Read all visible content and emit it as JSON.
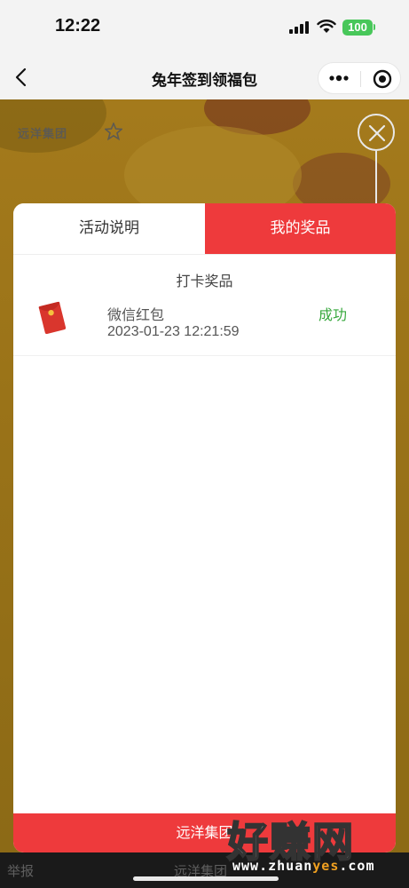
{
  "status_bar": {
    "time": "12:22",
    "battery": "100",
    "battery_color": "#48c75a"
  },
  "nav": {
    "title": "兔年签到领福包",
    "back_icon": "chevron-left-icon",
    "more_icon": "more-dots-icon",
    "target_icon": "target-icon"
  },
  "background": {
    "logo_text": "远洋集团"
  },
  "modal": {
    "tabs": [
      {
        "label": "活动说明",
        "active": false
      },
      {
        "label": "我的奖品",
        "active": true
      }
    ],
    "section_title": "打卡奖品",
    "prizes": [
      {
        "icon": "red-envelope-icon",
        "name": "微信红包",
        "time": "2023-01-23 12:21:59",
        "status": "成功",
        "status_color": "#37a83d"
      }
    ],
    "footer": "远洋集团",
    "accent_color": "#ee3a3c"
  },
  "bottom_bar": {
    "report": "举报",
    "footer": "远洋集团"
  },
  "watermark": {
    "main": "好赚网",
    "url_prefix": "www.zhuan",
    "url_highlight": "yes",
    "url_suffix": ".com"
  }
}
